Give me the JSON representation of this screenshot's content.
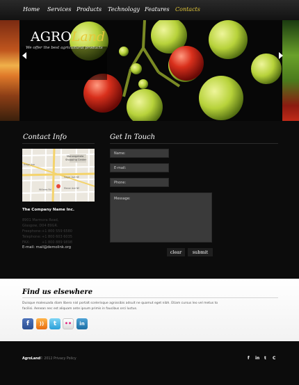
{
  "nav": {
    "items": [
      {
        "label": "Home",
        "active": false
      },
      {
        "label": "Services",
        "active": false
      },
      {
        "label": "Products",
        "active": false
      },
      {
        "label": "Technology",
        "active": false
      },
      {
        "label": "Features",
        "active": false
      },
      {
        "label": "Contacts",
        "active": true
      }
    ]
  },
  "hero": {
    "logo_part1": "AGRO",
    "logo_part2": "Land",
    "tagline": "We offer the best agricultural products"
  },
  "contact_info": {
    "title": "Contact Info",
    "company": "The Company Name Inc.",
    "address_lines": [
      "8901 Marmora Road,",
      "Glasgow, D04 89GR."
    ],
    "phones": [
      {
        "label": "Freephone:",
        "value": "+1 800 559 6580"
      },
      {
        "label": "Telephone:",
        "value": "+1 800 603 6035"
      },
      {
        "label": "FAX:",
        "value": "+1 800 889 9898"
      }
    ],
    "email_label": "E-mail:",
    "email": "mail@demolink.org"
  },
  "map": {
    "place_label_1": "Monongahela",
    "place_label_2": "Shopping Center",
    "street_labels": [
      "Ridge Ave",
      "Willams Rd",
      "Gayer Ave NE",
      "Manor Ave NE"
    ]
  },
  "get_in_touch": {
    "title": "Get In Touch",
    "name_placeholder": "Name:",
    "email_placeholder": "E-mail:",
    "phone_placeholder": "Phone:",
    "message_placeholder": "Message:",
    "clear_label": "clear",
    "submit_label": "submit"
  },
  "find_us": {
    "title": "Find us elsewhere",
    "text_line1": "Duisque malesuada diam libero nisl portalt scelerisque agnissibis adsuit ne quamut eget nibh. Etiam cursus leo vel metus to",
    "text_line2": "facilisi. Aenean nec est aliquam ante ipsum primis in faucibus orci luctus."
  },
  "social": {
    "icons": [
      "facebook-icon",
      "rss-icon",
      "twitter-icon",
      "flickr-icon",
      "linkedin-icon"
    ],
    "glyphs": [
      "f",
      "))",
      "t",
      "••",
      "in"
    ]
  },
  "footer": {
    "brand": "AgroLand",
    "copyright": "© 2012",
    "privacy": "Privacy Policy",
    "icon_glyphs": [
      "f",
      "in",
      "t",
      "C"
    ]
  },
  "colors": {
    "accent": "#e5c93a",
    "background": "#0c0c0c",
    "grape_green": "#b7d23a",
    "grape_red": "#d9301c"
  }
}
